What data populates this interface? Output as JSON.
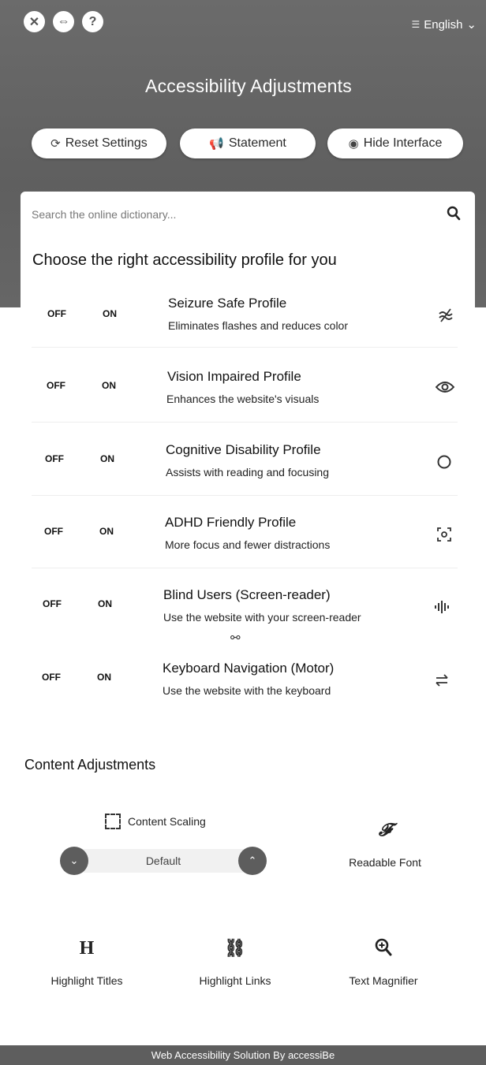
{
  "header": {
    "language": "English",
    "title": "Accessibility Adjustments",
    "buttons": {
      "reset": "Reset Settings",
      "statement": "Statement",
      "hide": "Hide Interface"
    }
  },
  "search": {
    "placeholder": "Search the online dictionary..."
  },
  "profiles": {
    "title": "Choose the right accessibility profile for you",
    "off_label": "OFF",
    "on_label": "ON",
    "items": [
      {
        "name": "Seizure Safe Profile",
        "desc": "Eliminates flashes and reduces color",
        "icon": "seizure-icon"
      },
      {
        "name": "Vision Impaired Profile",
        "desc": "Enhances the website's visuals",
        "icon": "eye-icon"
      },
      {
        "name": "Cognitive Disability Profile",
        "desc": "Assists with reading and focusing",
        "icon": "circle-icon"
      },
      {
        "name": "ADHD Friendly Profile",
        "desc": "More focus and fewer distractions",
        "icon": "focus-icon"
      },
      {
        "name": "Blind Users (Screen-reader)",
        "desc": "Use the website with your screen-reader",
        "icon": "audio-wave-icon"
      },
      {
        "name": "Keyboard Navigation (Motor)",
        "desc": "Use the website with the keyboard",
        "icon": "arrows-icon"
      }
    ]
  },
  "content": {
    "title": "Content Adjustments",
    "scaling_label": "Content Scaling",
    "scaling_value": "Default",
    "readable_font": "Readable Font",
    "highlight_titles": "Highlight Titles",
    "highlight_links": "Highlight Links",
    "text_magnifier": "Text Magnifier"
  },
  "footer": {
    "text": "Web Accessibility Solution By accessiBe"
  }
}
